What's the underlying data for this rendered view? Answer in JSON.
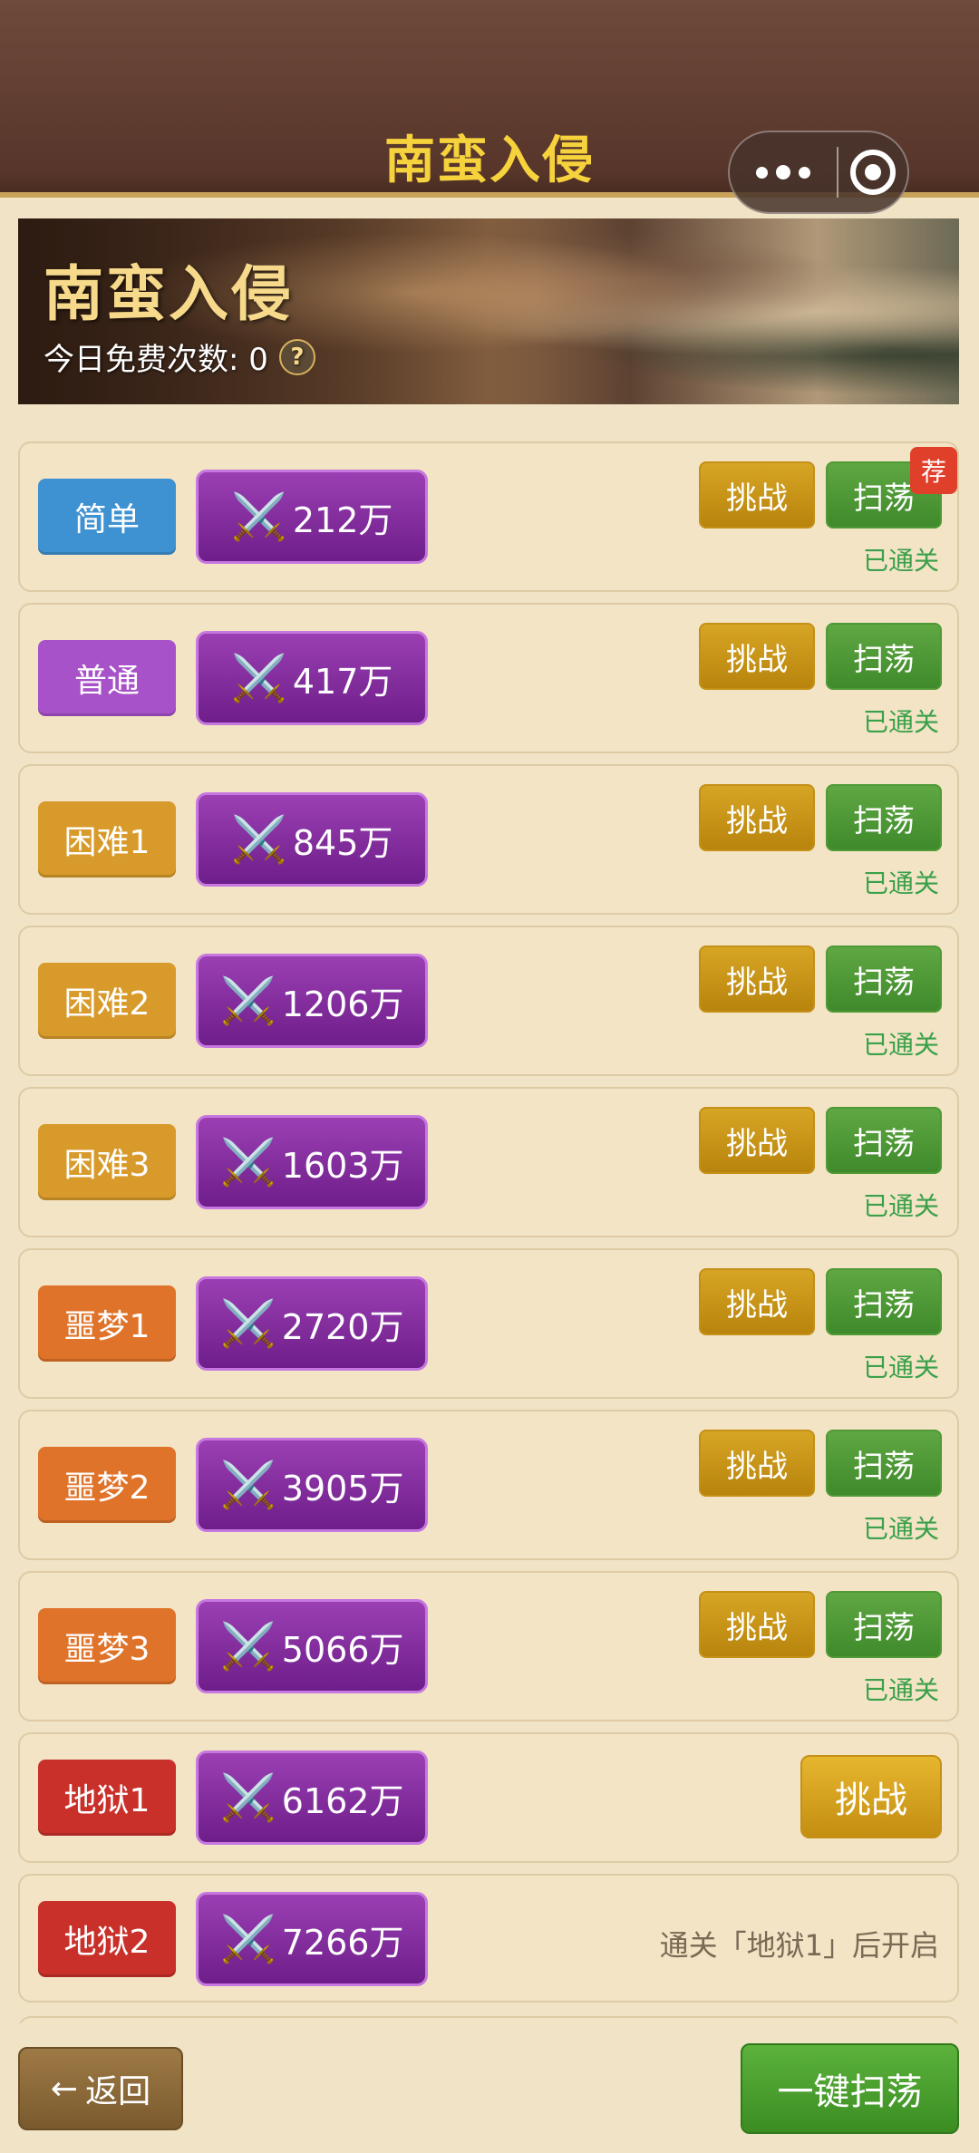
{
  "header": {
    "title": "南蛮入侵"
  },
  "banner": {
    "title": "南蛮入侵",
    "free_label": "今日免费次数: 0",
    "help": "?"
  },
  "buttons": {
    "challenge": "挑战",
    "sweep": "扫荡",
    "cleared": "已通关",
    "recommend": "荐",
    "swords": "⚔️"
  },
  "levels": [
    {
      "name": "简单",
      "power": "212万",
      "color": "#3f92d2",
      "status": "cleared",
      "recommended": true
    },
    {
      "name": "普通",
      "power": "417万",
      "color": "#a752c9",
      "status": "cleared"
    },
    {
      "name": "困难1",
      "power": "845万",
      "color": "#d89a2a",
      "status": "cleared"
    },
    {
      "name": "困难2",
      "power": "1206万",
      "color": "#d89a2a",
      "status": "cleared"
    },
    {
      "name": "困难3",
      "power": "1603万",
      "color": "#d89a2a",
      "status": "cleared"
    },
    {
      "name": "噩梦1",
      "power": "2720万",
      "color": "#e0732a",
      "status": "cleared"
    },
    {
      "name": "噩梦2",
      "power": "3905万",
      "color": "#e0732a",
      "status": "cleared"
    },
    {
      "name": "噩梦3",
      "power": "5066万",
      "color": "#e0732a",
      "status": "cleared"
    },
    {
      "name": "地狱1",
      "power": "6162万",
      "color": "#c9302a",
      "status": "open"
    },
    {
      "name": "地狱2",
      "power": "7266万",
      "color": "#c9302a",
      "status": "locked",
      "locked_text": "通关「地狱1」后开启"
    }
  ],
  "footer": {
    "back_arrow": "←",
    "back_label": "返回",
    "sweep_all": "一键扫荡"
  }
}
